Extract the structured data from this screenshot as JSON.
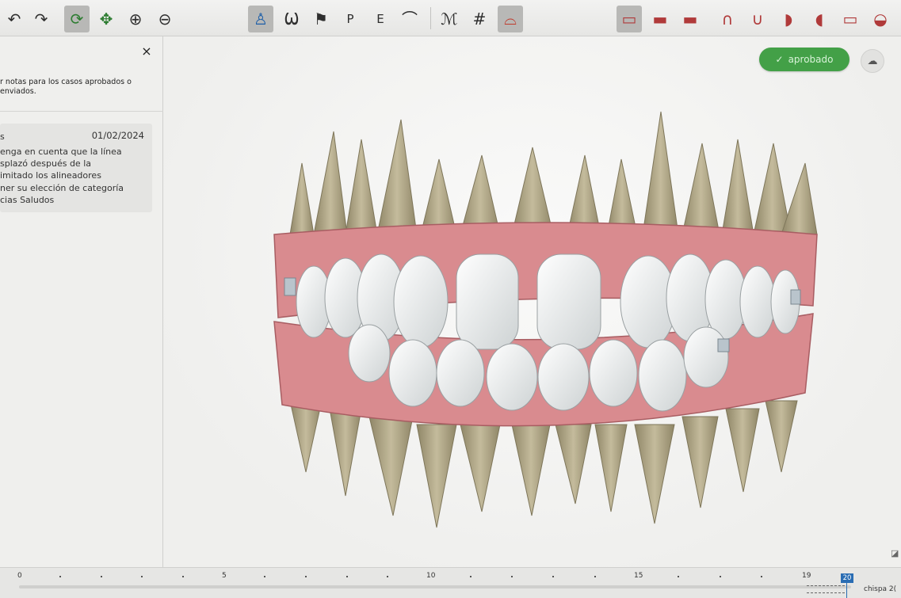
{
  "toolbar": {
    "tools": [
      {
        "icon": "undo-icon",
        "glyph": "↶"
      },
      {
        "icon": "redo-icon",
        "glyph": "↷"
      },
      {
        "icon": "rotate-icon",
        "glyph": "⟳"
      },
      {
        "icon": "move-icon",
        "glyph": "✥"
      },
      {
        "icon": "zoom-in-icon",
        "glyph": "⊕"
      },
      {
        "icon": "zoom-out-icon",
        "glyph": "⊖"
      },
      {
        "icon": "tooth-view-icon",
        "glyph": "♙"
      },
      {
        "icon": "root-view-icon",
        "glyph": "Ѡ"
      },
      {
        "icon": "checkered-flag-icon",
        "glyph": "⚑"
      },
      {
        "icon": "p-tooth-icon",
        "glyph": "P"
      },
      {
        "icon": "e-tooth-icon",
        "glyph": "E"
      },
      {
        "icon": "bone-icon",
        "glyph": "⌒"
      },
      {
        "icon": "ipr-icon",
        "glyph": "ℳ"
      },
      {
        "icon": "grid-icon",
        "glyph": "#"
      },
      {
        "icon": "gum-view-icon",
        "glyph": "⌓"
      },
      {
        "icon": "front-view-icon",
        "glyph": "▭"
      },
      {
        "icon": "upper-view-icon",
        "glyph": "▬"
      },
      {
        "icon": "lower-view-icon",
        "glyph": "▬"
      },
      {
        "icon": "upper-arch-icon",
        "glyph": "∩"
      },
      {
        "icon": "lower-arch-icon",
        "glyph": "∪"
      },
      {
        "icon": "right-view-icon",
        "glyph": "◗"
      },
      {
        "icon": "left-view-icon",
        "glyph": "◖"
      },
      {
        "icon": "posterior-view-icon",
        "glyph": "▭"
      },
      {
        "icon": "back-view-icon",
        "glyph": "◒"
      }
    ]
  },
  "notes_panel": {
    "close_glyph": "×",
    "hint": "r notas para los casos aprobados o\n enviados.",
    "note": {
      "author": "s",
      "date": "01/02/2024",
      "text": "enga en cuenta que la línea\nsplazó después de la\nimitado los alineadores\nner su elección de categoría\ncias Saludos"
    }
  },
  "viewport": {
    "status_badge": "aprobado",
    "check_glyph": "✓",
    "cloud_glyph": "☁",
    "colors": {
      "badge": "#43a047",
      "gum": "#d98b8f",
      "tooth": "#eef0f0",
      "root": "#b7ad8f"
    }
  },
  "timeline": {
    "labels": [
      "0",
      "5",
      "10",
      "15",
      "19",
      "20"
    ],
    "current_stage": "20",
    "spark_label": "chispa 2("
  }
}
